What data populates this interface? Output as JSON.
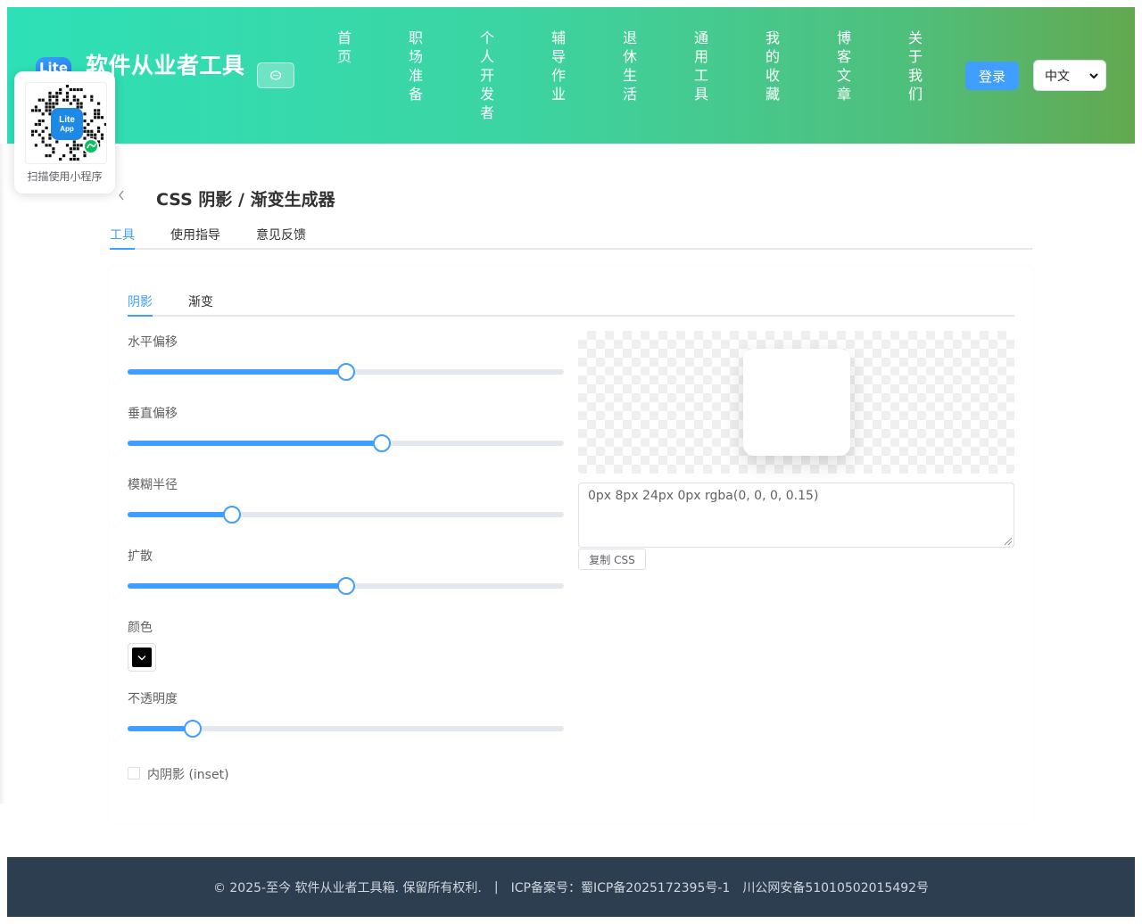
{
  "header": {
    "logo_text": "Lite",
    "site_title": "软件从业者工具",
    "nav": [
      "首页",
      "职场准备",
      "个人开发者",
      "辅导作业",
      "退休生活",
      "通用工具",
      "我的收藏",
      "博客文章",
      "关于我们"
    ],
    "login_label": "登录",
    "language": "中文"
  },
  "qr": {
    "logo_line1": "Lite",
    "logo_line2": "App",
    "caption": "扫描使用小程序"
  },
  "page": {
    "title": "CSS 阴影 / 渐变生成器",
    "tabs": [
      "工具",
      "使用指导",
      "意见反馈"
    ],
    "active_tab": "工具"
  },
  "tool": {
    "subtabs": [
      "阴影",
      "渐变"
    ],
    "active_subtab": "阴影",
    "controls": {
      "h_offset": {
        "label": "水平偏移",
        "level": 0.5
      },
      "v_offset": {
        "label": "垂直偏移",
        "level": 0.582
      },
      "blur": {
        "label": "模糊半径",
        "level": 0.24
      },
      "spread": {
        "label": "扩散",
        "level": 0.5
      },
      "color": {
        "label": "颜色",
        "value": "#000000"
      },
      "opacity": {
        "label": "不透明度",
        "level": 0.15
      }
    },
    "inset_label": "内阴影 (inset)",
    "inset_checked": false,
    "css_output": "0px 8px 24px 0px rgba(0, 0, 0, 0.15)",
    "copy_label": "复制 CSS"
  },
  "footer": {
    "copyright": "© 2025-至今 软件从业者工具箱. 保留所有权利.",
    "separator": "|",
    "icp": "ICP备案号：蜀ICP备2025172395号-1",
    "police": "川公网安备51010502015492号"
  },
  "colors": {
    "accent": "#409eff",
    "header_gradient_start": "#2ee0b7",
    "header_gradient_end": "#63a84f",
    "footer_bg": "#2c3e50"
  }
}
